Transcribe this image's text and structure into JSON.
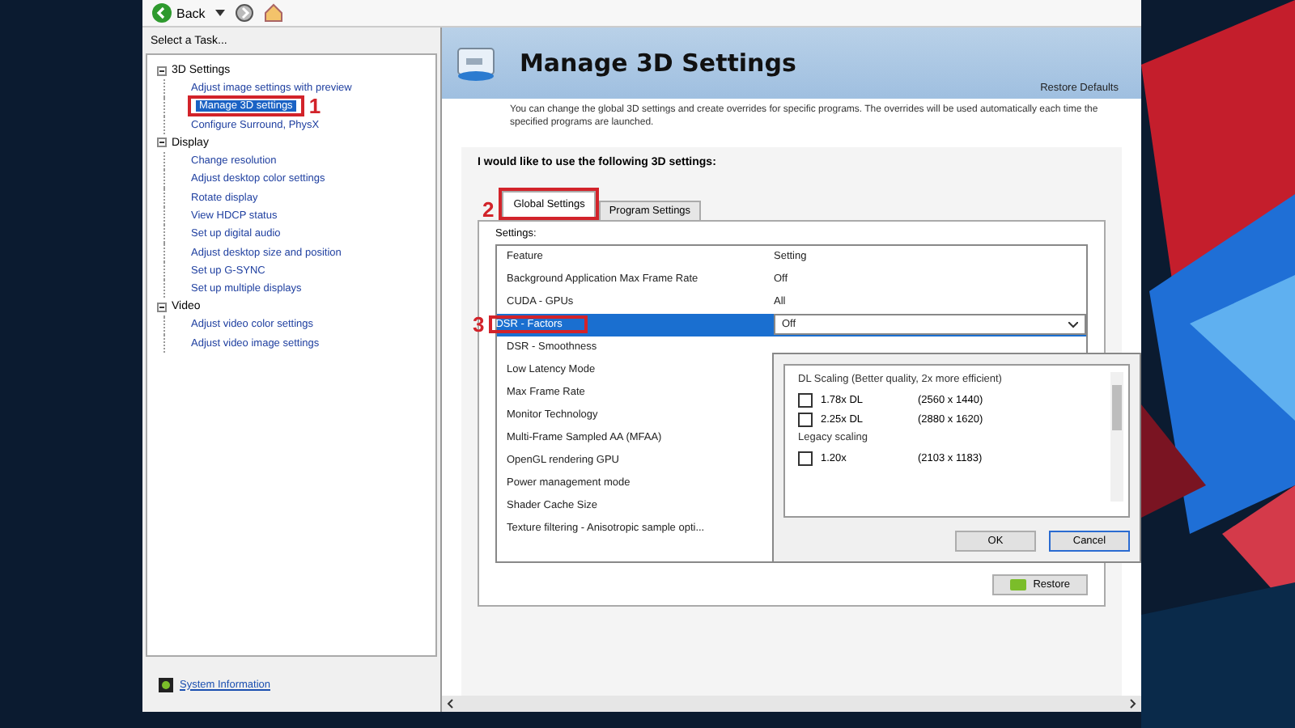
{
  "toolbar": {
    "back_label": "Back"
  },
  "sidebar": {
    "title": "Select a Task...",
    "groups": [
      {
        "label": "3D Settings",
        "expanded": true,
        "children": [
          {
            "label": "Adjust image settings with preview",
            "selected": false
          },
          {
            "label": "Manage 3D settings",
            "selected": true,
            "marker": "1"
          },
          {
            "label": "Configure Surround, PhysX",
            "selected": false
          }
        ]
      },
      {
        "label": "Display",
        "expanded": true,
        "children": [
          {
            "label": "Change resolution",
            "selected": false
          },
          {
            "label": "Adjust desktop color settings",
            "selected": false
          },
          {
            "label": "Rotate display",
            "selected": false
          },
          {
            "label": "View HDCP status",
            "selected": false
          },
          {
            "label": "Set up digital audio",
            "selected": false
          },
          {
            "label": "Adjust desktop size and position",
            "selected": false
          },
          {
            "label": "Set up G-SYNC",
            "selected": false
          },
          {
            "label": "Set up multiple displays",
            "selected": false
          }
        ]
      },
      {
        "label": "Video",
        "expanded": true,
        "children": [
          {
            "label": "Adjust video color settings",
            "selected": false
          },
          {
            "label": "Adjust video image settings",
            "selected": false
          }
        ]
      }
    ],
    "footer_link": "System Information"
  },
  "page": {
    "title": "Manage 3D Settings",
    "restore_link": "Restore Defaults",
    "description": "You can change the global 3D settings and create overrides for specific programs. The overrides will be used automatically each time the specified programs are launched.",
    "section_title": "I would like to use the following 3D settings:",
    "tabs": [
      {
        "label": "Global Settings",
        "selected": true,
        "marker": "2"
      },
      {
        "label": "Program Settings",
        "selected": false
      }
    ],
    "settings_label": "Settings:",
    "columns": [
      "Feature",
      "Setting"
    ],
    "rows": [
      {
        "feature": "Background Application Max Frame Rate",
        "setting": "Off",
        "selected": false
      },
      {
        "feature": "CUDA - GPUs",
        "setting": "All",
        "selected": false
      },
      {
        "feature": "DSR - Factors",
        "setting": "Off",
        "selected": true,
        "marker": "3"
      },
      {
        "feature": "DSR - Smoothness",
        "selected": false
      },
      {
        "feature": "Low Latency Mode",
        "selected": false
      },
      {
        "feature": "Max Frame Rate",
        "selected": false
      },
      {
        "feature": "Monitor Technology",
        "selected": false
      },
      {
        "feature": "Multi-Frame Sampled AA (MFAA)",
        "selected": false
      },
      {
        "feature": "OpenGL rendering GPU",
        "selected": false
      },
      {
        "feature": "Power management mode",
        "selected": false
      },
      {
        "feature": "Shader Cache Size",
        "selected": false
      },
      {
        "feature": "Texture filtering - Anisotropic sample opti...",
        "selected": false
      }
    ],
    "restore_button": "Restore"
  },
  "dropdown": {
    "groups": [
      {
        "label": "DL Scaling (Better quality, 2x more efficient)",
        "options": [
          {
            "label": "1.78x DL",
            "resolution": "(2560 x 1440)",
            "checked": false
          },
          {
            "label": "2.25x DL",
            "resolution": "(2880 x 1620)",
            "checked": false
          }
        ]
      },
      {
        "label": "Legacy scaling",
        "options": [
          {
            "label": "1.20x",
            "resolution": "(2103 x 1183)",
            "checked": false
          }
        ]
      }
    ],
    "buttons": [
      {
        "label": "OK",
        "default": false
      },
      {
        "label": "Cancel",
        "default": true
      }
    ]
  }
}
